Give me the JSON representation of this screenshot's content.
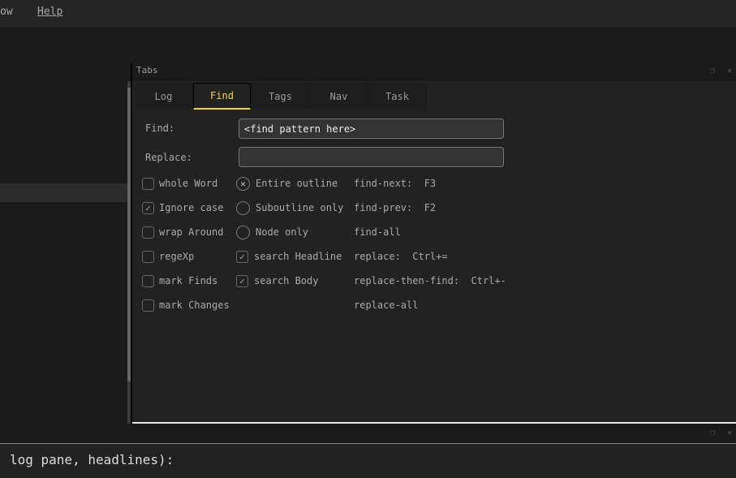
{
  "menubar": {
    "items": [
      {
        "label": "ow"
      },
      {
        "label": "Help"
      }
    ]
  },
  "dock": {
    "title": "Tabs"
  },
  "tabs": [
    {
      "label": "Log"
    },
    {
      "label": "Find",
      "active": true
    },
    {
      "label": "Tags"
    },
    {
      "label": "Nav"
    },
    {
      "label": "Task"
    }
  ],
  "find": {
    "find_label": "Find:",
    "find_value": "<find pattern here>",
    "replace_label": "Replace:",
    "replace_value": "",
    "options": [
      {
        "label": "whole Word",
        "checked": false
      },
      {
        "label": "Ignore case",
        "checked": true
      },
      {
        "label": "wrap Around",
        "checked": false
      },
      {
        "label": "regeXp",
        "checked": false
      },
      {
        "label": "mark Finds",
        "checked": false
      },
      {
        "label": "mark Changes",
        "checked": false
      }
    ],
    "scope": [
      {
        "label": "Entire outline",
        "selected": true
      },
      {
        "label": "Suboutline only",
        "selected": false
      },
      {
        "label": "Node only",
        "selected": false
      }
    ],
    "search": [
      {
        "label": "search Headline",
        "checked": true
      },
      {
        "label": "search Body",
        "checked": true
      }
    ],
    "commands": [
      "find-next:  F3",
      "find-prev:  F2",
      "find-all",
      "replace:  Ctrl+=",
      "replace-then-find:  Ctrl+-",
      "replace-all"
    ]
  },
  "log": {
    "text": "log pane, headlines):"
  },
  "colors": {
    "accent": "#f0d24a",
    "background": "#222222"
  }
}
